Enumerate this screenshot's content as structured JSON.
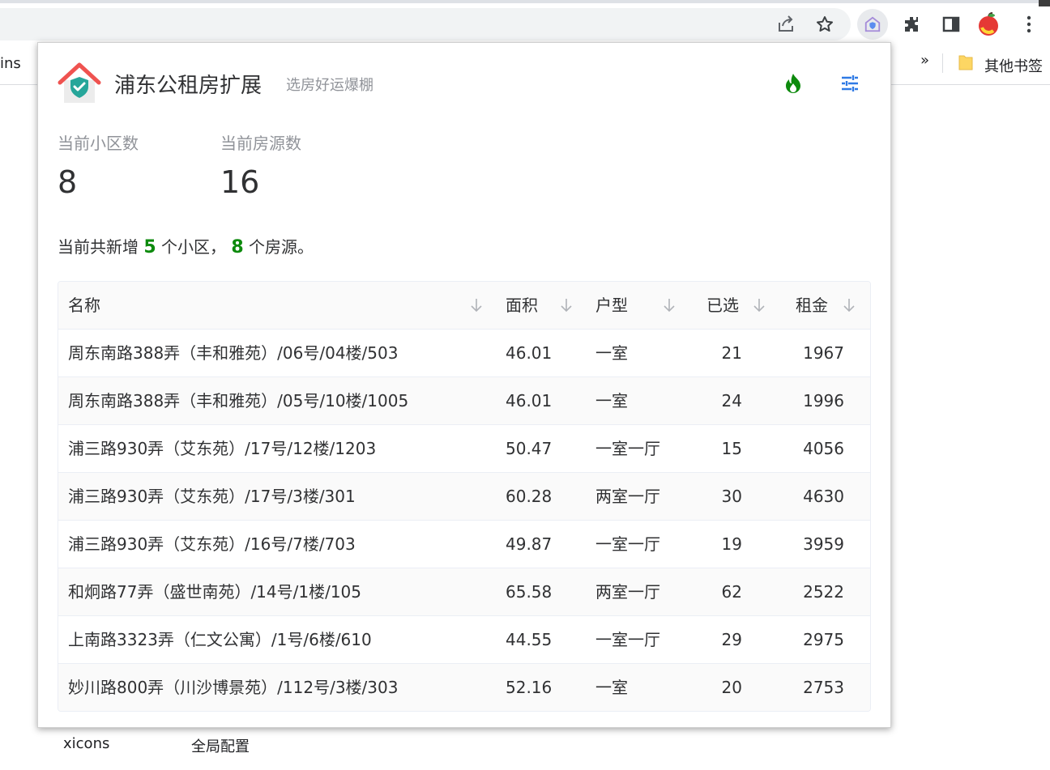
{
  "browser": {
    "bookmark_left_partial": "ins",
    "bookmarks_overflow": "»",
    "other_bookmarks": "其他书签",
    "toolbar_icons": [
      "share-icon",
      "star-icon",
      "extension-shield-icon",
      "puzzle-icon",
      "side-panel-icon",
      "profile-apple-icon",
      "kebab-menu-icon"
    ]
  },
  "page_behind": {
    "left_text": "xicons",
    "right_text": "全局配置"
  },
  "popup": {
    "title": "浦东公租房扩展",
    "subtitle": "选房好运爆棚",
    "header_icons": [
      "fire-icon",
      "settings-sliders-icon"
    ],
    "accent_color": "#0d8a0d",
    "icon_blue": "#2f7ae5",
    "stats": [
      {
        "label": "当前小区数",
        "value": "8"
      },
      {
        "label": "当前房源数",
        "value": "16"
      }
    ],
    "summary": {
      "prefix": "当前共新增 ",
      "new_communities": "5",
      "middle": " 个小区， ",
      "new_listings": "8",
      "suffix": " 个房源。"
    },
    "table": {
      "columns": [
        "名称",
        "面积",
        "户型",
        "已选",
        "租金"
      ],
      "rows": [
        {
          "name": "周东南路388弄（丰和雅苑）/06号/04楼/503",
          "area": "46.01",
          "type": "一室",
          "selected": "21",
          "rent": "1967"
        },
        {
          "name": "周东南路388弄（丰和雅苑）/05号/10楼/1005",
          "area": "46.01",
          "type": "一室",
          "selected": "24",
          "rent": "1996"
        },
        {
          "name": "浦三路930弄（艾东苑）/17号/12楼/1203",
          "area": "50.47",
          "type": "一室一厅",
          "selected": "15",
          "rent": "4056"
        },
        {
          "name": "浦三路930弄（艾东苑）/17号/3楼/301",
          "area": "60.28",
          "type": "两室一厅",
          "selected": "30",
          "rent": "4630"
        },
        {
          "name": "浦三路930弄（艾东苑）/16号/7楼/703",
          "area": "49.87",
          "type": "一室一厅",
          "selected": "19",
          "rent": "3959"
        },
        {
          "name": "和炯路77弄（盛世南苑）/14号/1楼/105",
          "area": "65.58",
          "type": "两室一厅",
          "selected": "62",
          "rent": "2522"
        },
        {
          "name": "上南路3323弄（仁文公寓）/1号/6楼/610",
          "area": "44.55",
          "type": "一室一厅",
          "selected": "29",
          "rent": "2975"
        },
        {
          "name": "妙川路800弄（川沙博景苑）/112号/3楼/303",
          "area": "52.16",
          "type": "一室",
          "selected": "20",
          "rent": "2753"
        }
      ]
    }
  }
}
